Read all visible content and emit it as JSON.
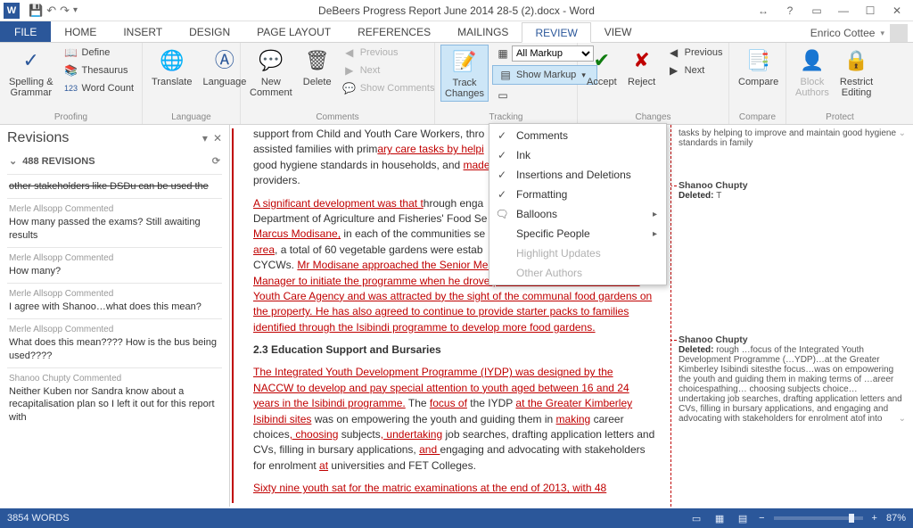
{
  "title_doc": "DeBeers Progress Report June 2014 28-5 (2).docx - Word",
  "user": "Enrico Cottee",
  "tabs": {
    "file": "FILE",
    "home": "HOME",
    "insert": "INSERT",
    "design": "DESIGN",
    "pagelayout": "PAGE LAYOUT",
    "references": "REFERENCES",
    "mailings": "MAILINGS",
    "review": "REVIEW",
    "view": "VIEW"
  },
  "ribbon": {
    "proofing": {
      "spelling": "Spelling &\nGrammar",
      "define": "Define",
      "thesaurus": "Thesaurus",
      "wordcount": "Word Count",
      "label": "Proofing"
    },
    "language": {
      "translate": "Translate",
      "language": "Language",
      "label": "Language"
    },
    "comments": {
      "new": "New\nComment",
      "delete": "Delete",
      "previous": "Previous",
      "next": "Next",
      "show": "Show Comments",
      "label": "Comments"
    },
    "tracking": {
      "track": "Track\nChanges",
      "allmarkup": "All Markup",
      "showmarkup": "Show Markup",
      "label": "Tracking"
    },
    "changes": {
      "accept": "Accept",
      "reject": "Reject",
      "previous": "Previous",
      "next": "Next",
      "label": "Changes"
    },
    "compare": {
      "compare": "Compare",
      "label": "Compare"
    },
    "protect": {
      "block": "Block\nAuthors",
      "restrict": "Restrict\nEditing",
      "label": "Protect"
    }
  },
  "dropdown": {
    "comments": "Comments",
    "ink": "Ink",
    "insdel": "Insertions and Deletions",
    "formatting": "Formatting",
    "balloons": "Balloons",
    "specific": "Specific People",
    "highlight": "Highlight Updates",
    "other": "Other Authors"
  },
  "revisions": {
    "title": "Revisions",
    "count": "488 REVISIONS",
    "items": [
      {
        "meta": "",
        "text": "other stakeholders like DSDu can be used the"
      },
      {
        "meta": "Merle Allsopp Commented",
        "text": "How many passed the exams? Still awaiting results"
      },
      {
        "meta": "Merle Allsopp Commented",
        "text": "How many?"
      },
      {
        "meta": "Merle Allsopp Commented",
        "text": "I agree with Shanoo…what does this mean?"
      },
      {
        "meta": "Merle Allsopp Commented",
        "text": "What does this mean????  How is the bus being used????"
      },
      {
        "meta": "Shanoo Chupty Commented",
        "text": "Neither Kuben nor Sandra know about a recapitalisation plan so I left it out for this report with"
      }
    ]
  },
  "doc": {
    "p1a": "support from Child and Youth Care Workers, thro",
    "p1b": "assisted families with prim",
    "p1c": "ary care tasks by helpi",
    "p1d": "good hygiene standards in households, and ",
    "p1e": "made",
    "p1f": "providers.",
    "p2ins": "A significant development was that t",
    "p2a": "hrough enga",
    "p2b": "Department of Agriculture and Fisheries' Food Se",
    "p2c": "Marcus Modisane,",
    "p2d": " in each of the communities se",
    "p2e": "area",
    "p2f": ", a total of 60 vegetable gardens were estab",
    "p2g": "CYCWs. ",
    "p2h": "Mr Modisane approached the Senior Mentor and the Donderhoek Project Manager to initiate the programme when he drove pass the Alfred Rens Child and Youth Care Agency and was attracted by the sight of the communal food gardens on the property. He has also agreed to continue to provide starter packs to families identified through the Isibindi programme to develop more food gardens.",
    "h23": "2.3 Education Support and Bursaries",
    "p3a": "The Integrated Youth Development Programme (IYDP) was designed by the NACCW to develop and pay special attention to youth aged between 16 and 24 years in the Isibindi programme.",
    "p3b": " The ",
    "p3c": "focus of",
    "p3d": " the IYDP ",
    "p3e": "at the Greater Kimberley Isibindi sites",
    "p3f": " was on empowering the youth and guiding them in ",
    "p3g": "making",
    "p3h": " career choices",
    "p3i": ", choosing",
    "p3j": " subjects",
    "p3k": ", undertaking",
    "p3l": " job searches, drafting application letters and CVs, filling in bursary applications, ",
    "p3m": "and ",
    "p3n": "engaging and advocating with stakeholders for enrolment ",
    "p3o": "at",
    "p3p": " universities and FET Colleges.",
    "p4": "Sixty nine youth sat for the matric examinations at the end of 2013, with 48"
  },
  "markup": {
    "m0": "tasks by helping to improve and maintain good hygiene standards in family",
    "a1": "Shanoo Chupty",
    "d1": "Deleted: ",
    "d1v": "T",
    "a2": "Shanoo Chupty",
    "d2": "Deleted: ",
    "d2v": "rough …focus of the Integrated Youth Development Programme (…YDP)…at the Greater Kimberley Isibindi sitesthe focus…was on empowering the youth and guiding them in making terms of …areer choicespathing… choosing subjects choice… undertaking job searches, drafting application letters and CVs, filling in bursary applications, and engaging and advocating with stakeholders for enrolment atof into"
  },
  "status": {
    "words": "3854 WORDS",
    "zoom": "87%"
  }
}
